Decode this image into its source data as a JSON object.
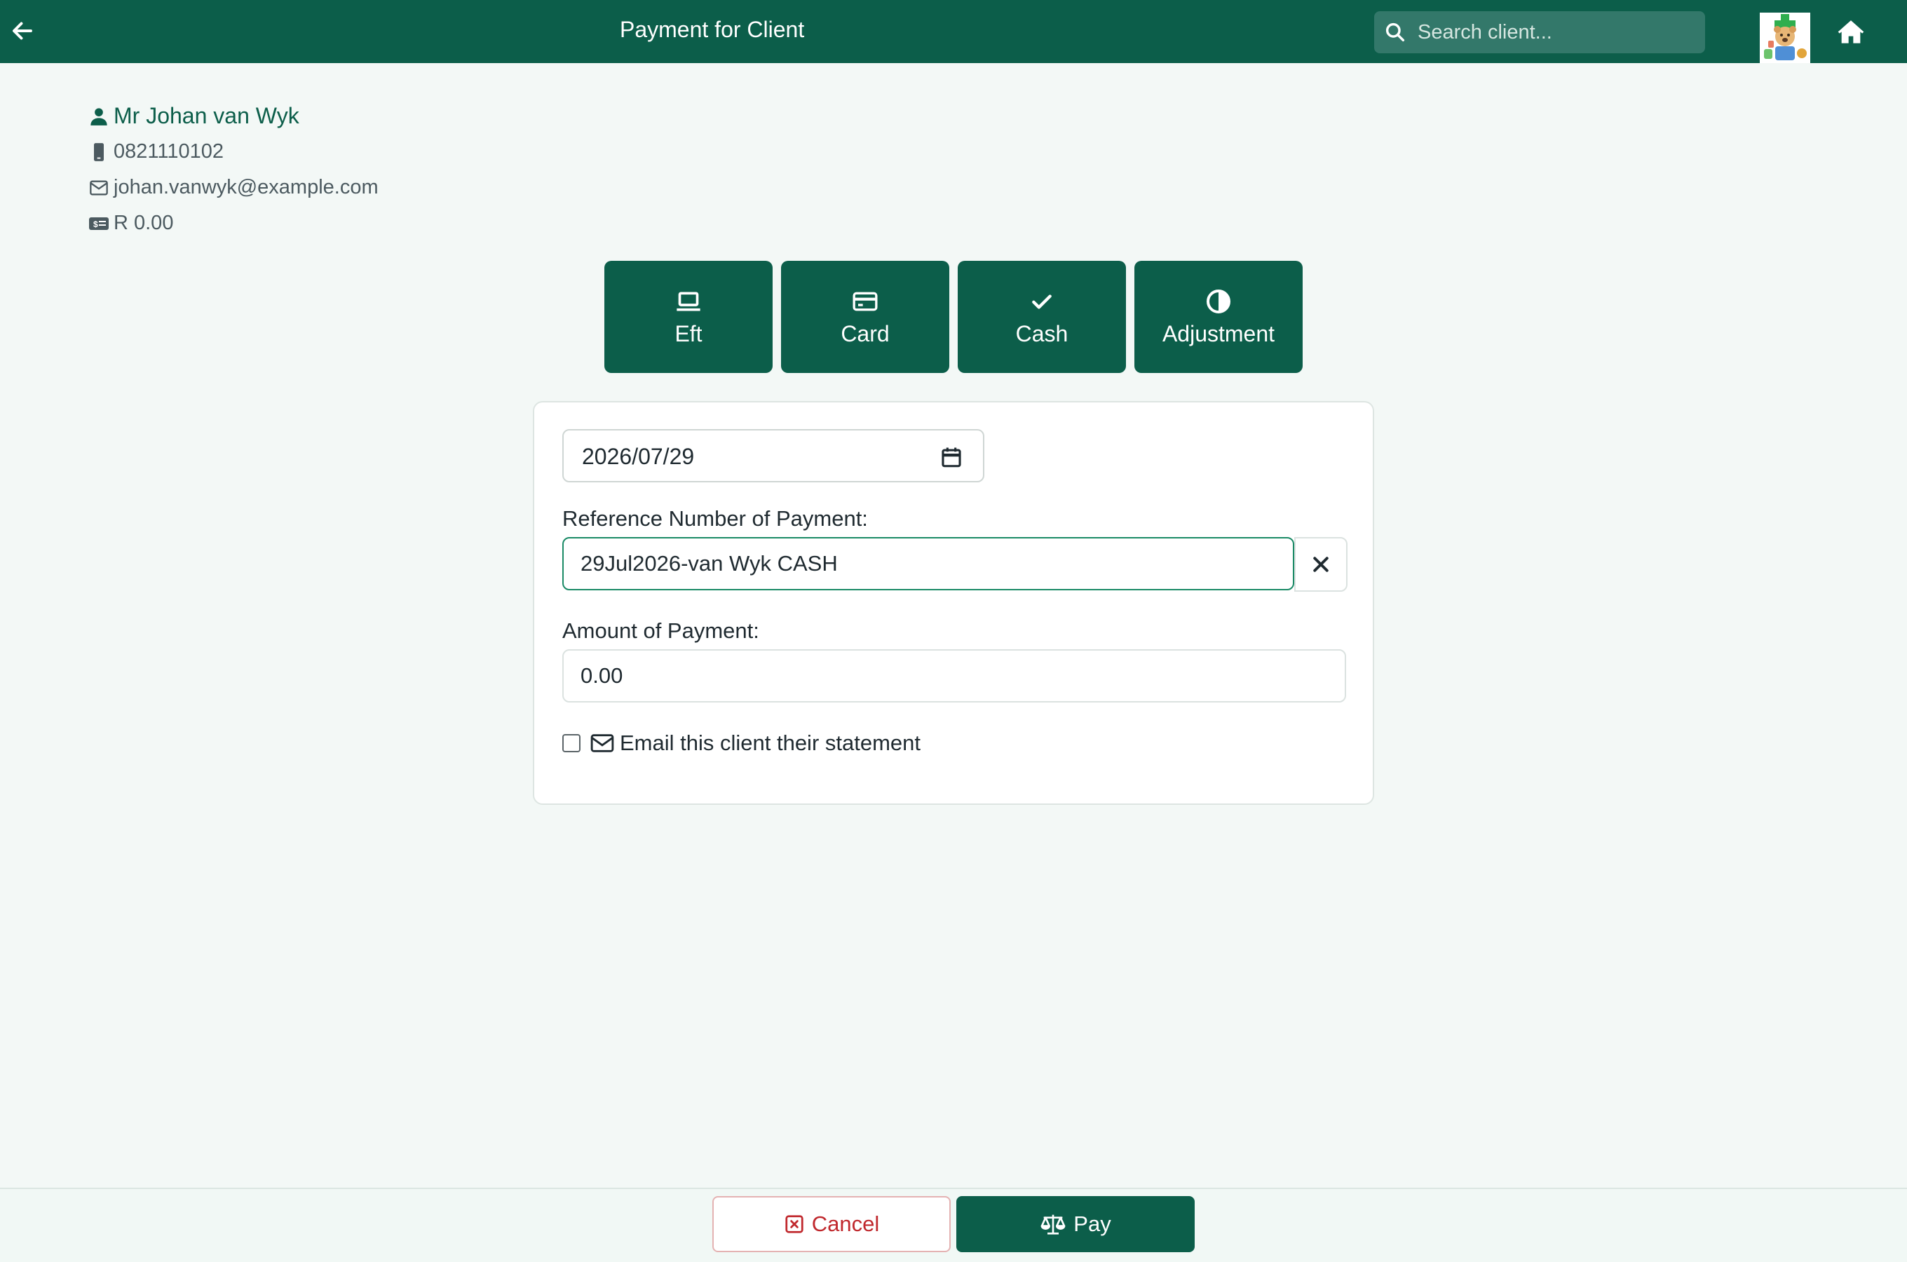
{
  "header": {
    "title": "Payment for Client",
    "search_placeholder": "Search client...",
    "back_icon": "arrow-left-icon",
    "home_icon": "home-icon",
    "brand_color": "#0c5e4a"
  },
  "client": {
    "name": "Mr Johan van Wyk",
    "phone": "0821110102",
    "email": "johan.vanwyk@example.com",
    "balance": "R 0.00"
  },
  "payment_types": [
    {
      "label": "Eft",
      "icon": "laptop-icon"
    },
    {
      "label": "Card",
      "icon": "credit-card-icon"
    },
    {
      "label": "Cash",
      "icon": "check-icon"
    },
    {
      "label": "Adjustment",
      "icon": "half-circle-icon"
    }
  ],
  "form": {
    "date_value": "2026/07/29",
    "reference_label": "Reference Number of Payment:",
    "reference_value": "29Jul2026-van Wyk CASH",
    "amount_label": "Amount of Payment:",
    "amount_value": "0.00",
    "email_statement_label": "Email this client their statement",
    "email_statement_checked": false
  },
  "footer": {
    "cancel_label": "Cancel",
    "pay_label": "Pay",
    "cancel_color": "#c0282d"
  }
}
